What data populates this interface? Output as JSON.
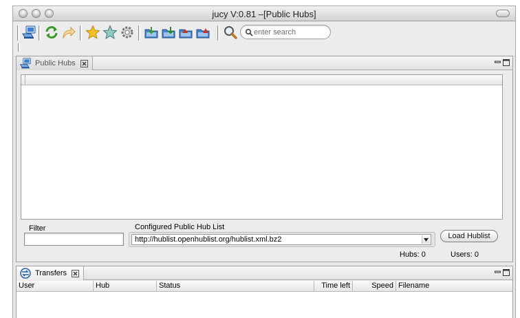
{
  "window": {
    "title": "jucy V:0.81 –[Public Hubs]"
  },
  "toolbar": {
    "icons": [
      "public-hubs-icon",
      "reconnect-icon",
      "follow-redirect-icon",
      "favorite-hubs-icon",
      "favorite-users-icon",
      "settings-icon",
      "hub-list-download-icon",
      "download-queue-icon",
      "finished-downloads-icon",
      "finished-uploads-icon",
      "search-icon"
    ],
    "search_placeholder": "enter search"
  },
  "public_hubs": {
    "tab_label": "Public Hubs",
    "filter_label": "Filter",
    "filter_value": "",
    "hublist_label": "Configured Public Hub List",
    "hublist_selected": "http://hublist.openhublist.org/hublist.xml.bz2",
    "load_button": "Load Hublist",
    "hubs_count": "Hubs: 0",
    "users_count": "Users: 0"
  },
  "transfers": {
    "tab_label": "Transfers",
    "columns": [
      "User",
      "Hub",
      "Status",
      "Time left",
      "Speed",
      "Filename"
    ]
  },
  "colors": {
    "accent_green": "#3a9a2a",
    "star_yellow": "#f3c22a",
    "folder_blue": "#4a86c8"
  }
}
